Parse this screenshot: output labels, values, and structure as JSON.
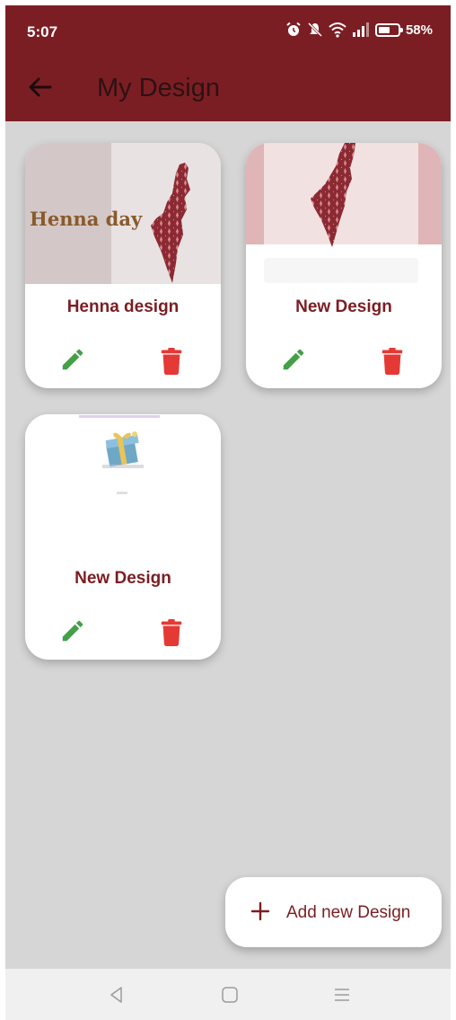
{
  "status": {
    "time": "5:07",
    "battery": "58%",
    "battery_level": 0.58,
    "icons": [
      "alarm-icon",
      "mute-icon",
      "wifi-icon",
      "signal-icon",
      "battery-icon"
    ]
  },
  "appbar": {
    "title": "My Design"
  },
  "cards": [
    {
      "title": "Henna design",
      "thumb_text": "Henna day"
    },
    {
      "title": "New Design"
    },
    {
      "title": "New Design"
    }
  ],
  "fab": {
    "label": "Add new Design"
  },
  "colors": {
    "primary": "#7b1e23",
    "edit": "#43a047",
    "delete": "#e53935",
    "background": "#d6d6d6"
  }
}
